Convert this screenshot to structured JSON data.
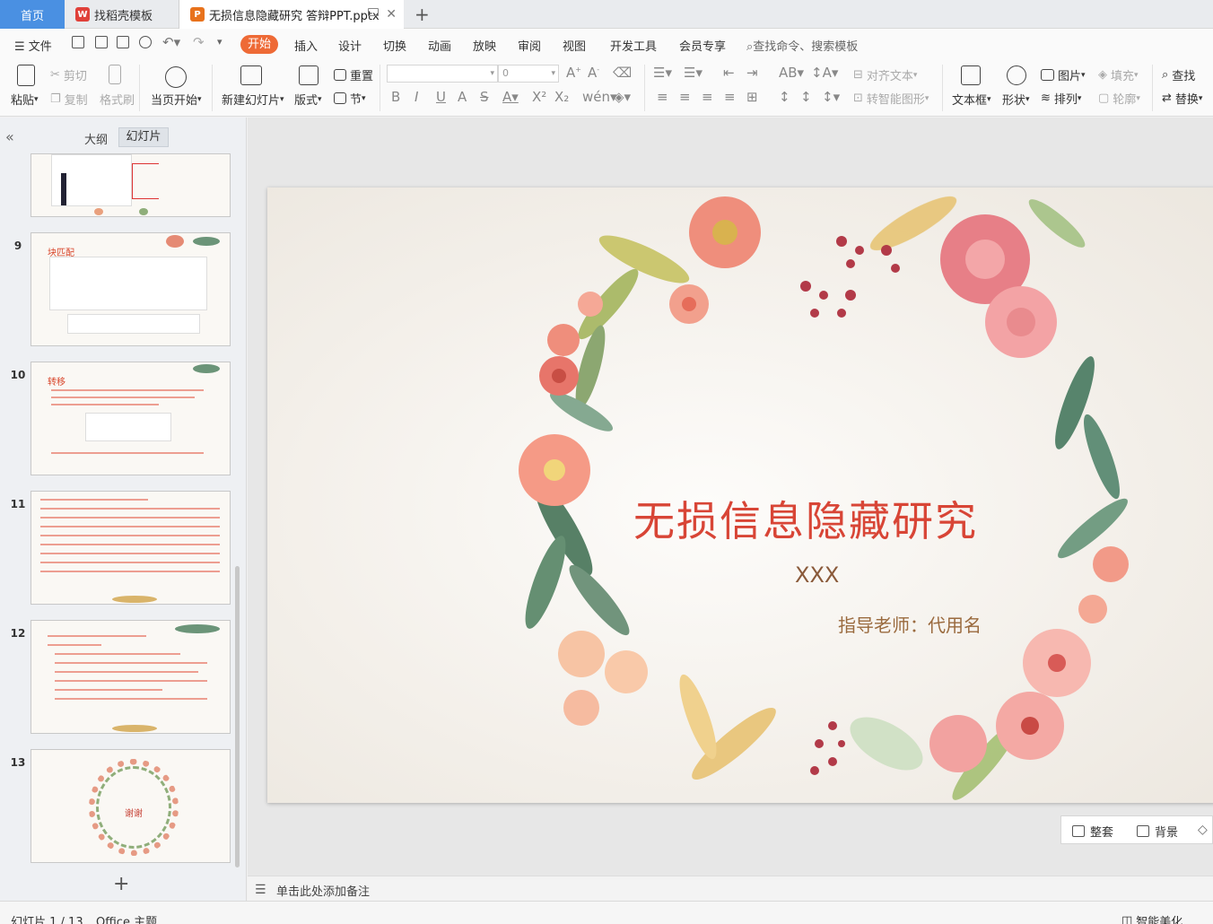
{
  "tabs": {
    "home": "首页",
    "template": "找稻壳模板",
    "document": "无损信息隐藏研究 答辩PPT.pptx"
  },
  "menu": {
    "file": "文件",
    "items": [
      "开始",
      "插入",
      "设计",
      "切换",
      "动画",
      "放映",
      "审阅",
      "视图",
      "开发工具",
      "会员专享"
    ],
    "search": "查找命令、搜索模板"
  },
  "ribbon": {
    "paste": "粘贴",
    "cut": "剪切",
    "copy": "复制",
    "format_painter": "格式刷",
    "play_from_current": "当页开始",
    "new_slide": "新建幻灯片",
    "layout": "版式",
    "reset": "重置",
    "section": "节",
    "font_size_value": "0",
    "align_text": "对齐文本",
    "smartart": "转智能图形",
    "textbox": "文本框",
    "shape": "形状",
    "picture": "图片",
    "arrange": "排列",
    "fill": "填充",
    "outline": "轮廓",
    "find": "查找",
    "replace": "替换"
  },
  "left_panel": {
    "tab_outline": "大纲",
    "tab_slides": "幻灯片",
    "thumbnails": [
      {
        "num": "9",
        "title": "块匹配"
      },
      {
        "num": "10",
        "title": "转移"
      },
      {
        "num": "11",
        "title": ""
      },
      {
        "num": "12",
        "title": ""
      },
      {
        "num": "13",
        "title": "谢谢"
      }
    ]
  },
  "slide": {
    "title": "无损信息隐藏研究",
    "author": "XXX",
    "advisor": "指导老师：代用名"
  },
  "float_toolbar": {
    "arrange": "整套",
    "background": "背景"
  },
  "notes": {
    "placeholder": "单击此处添加备注"
  },
  "status": {
    "slide_info": "幻灯片 1 / 13",
    "theme": "Office 主题",
    "beautify": "智能美化"
  },
  "colors": {
    "accent": "#ee6a36",
    "home_tab": "#4a90e2",
    "title_red": "#d84536"
  }
}
